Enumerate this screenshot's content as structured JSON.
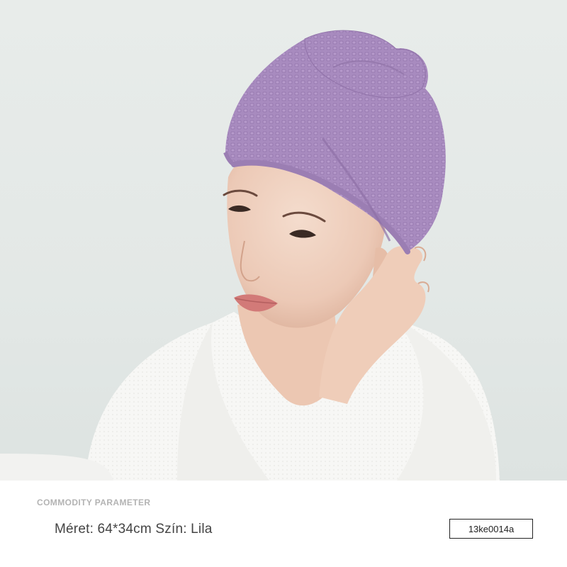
{
  "product_image": {
    "subject": "woman-wearing-lilac-hair-towel-turban-and-white-robe",
    "towel_color": "#a98bbf",
    "robe_color": "#f6f6f4",
    "background_color": "#e5e9e7"
  },
  "parameters": {
    "section_title": "COMMODITY PARAMETER",
    "spec_line": "Méret: 64*34cm Szín: Lila",
    "sku": "13ke0014a"
  }
}
